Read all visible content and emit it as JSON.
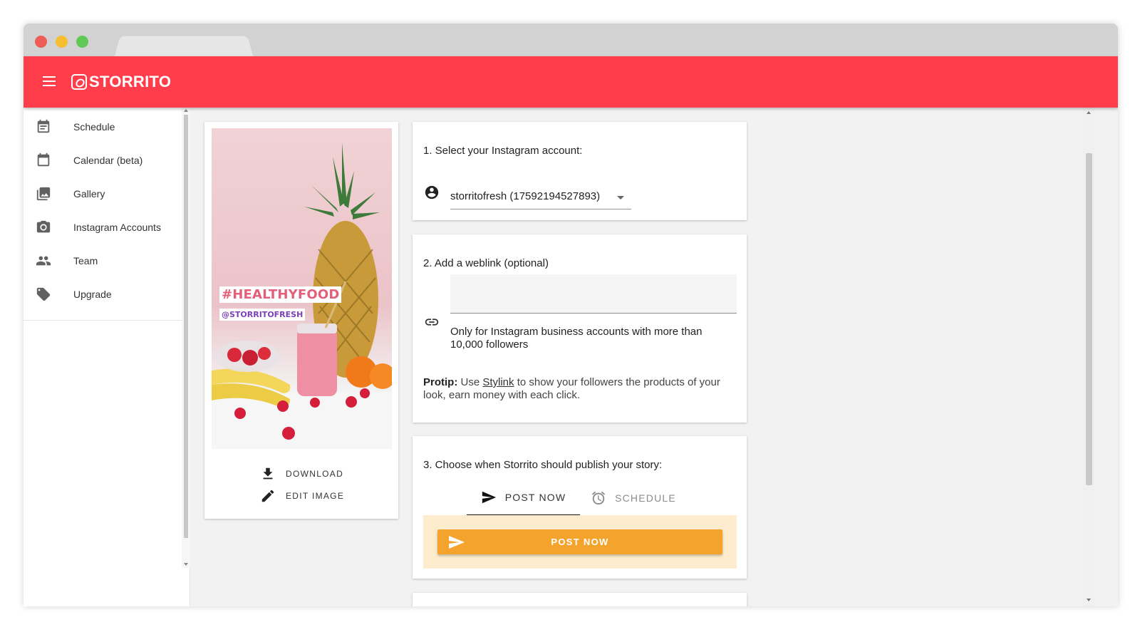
{
  "app": {
    "brand": "STORRITO",
    "accent_color": "#ff3d4b",
    "cta_color": "#f4a42d"
  },
  "sidebar": {
    "items": [
      {
        "label": "Schedule",
        "icon": "schedule-icon"
      },
      {
        "label": "Calendar (beta)",
        "icon": "calendar-icon"
      },
      {
        "label": "Gallery",
        "icon": "gallery-icon"
      },
      {
        "label": "Instagram Accounts",
        "icon": "camera-icon"
      },
      {
        "label": "Team",
        "icon": "team-icon"
      },
      {
        "label": "Upgrade",
        "icon": "tag-icon"
      }
    ]
  },
  "preview": {
    "hashtag": "#HEALTHYFOOD",
    "mention": "@STORRITOFRESH",
    "download_label": "DOWNLOAD",
    "edit_label": "EDIT IMAGE"
  },
  "step1": {
    "title": "1. Select your Instagram account:",
    "selected_account": "storritofresh (17592194527893)"
  },
  "step2": {
    "title": "2. Add a weblink (optional)",
    "input_value": "",
    "helper": "Only for Instagram business accounts with more than 10,000 followers",
    "protip_label": "Protip:",
    "protip_pre": " Use ",
    "protip_link": "Stylink",
    "protip_post": " to show your followers the products of your look, earn money with each click."
  },
  "step3": {
    "title": "3. Choose when Storrito should publish your story:",
    "tab_post": "POST NOW",
    "tab_schedule": "SCHEDULE",
    "active_tab": "POST NOW",
    "post_button": "POST NOW"
  }
}
